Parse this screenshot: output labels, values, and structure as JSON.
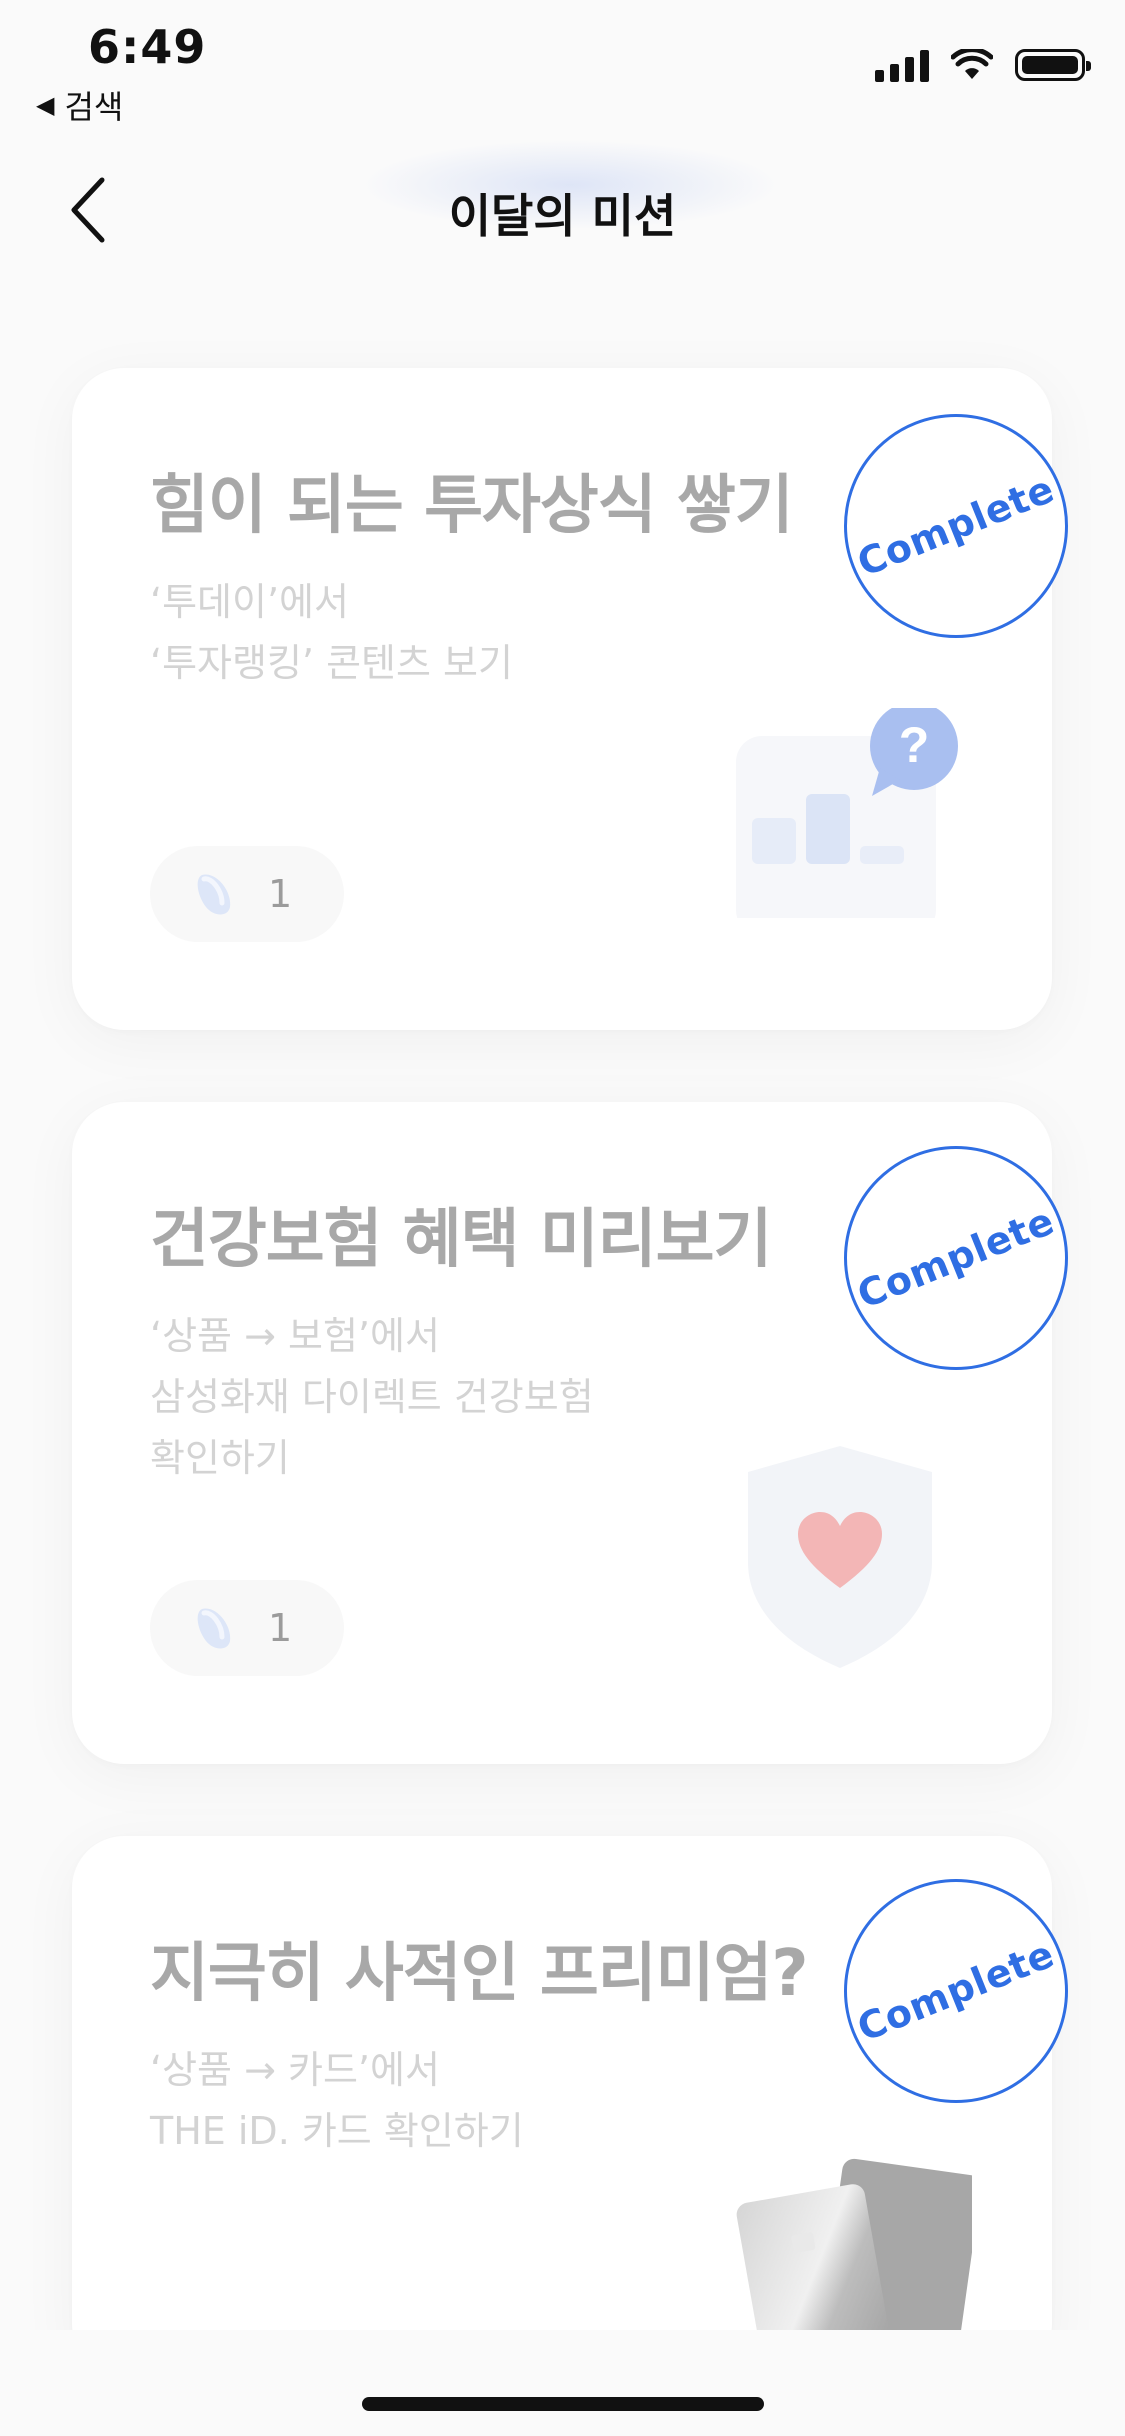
{
  "status_bar": {
    "time": "6:49",
    "back_app_label": "검색"
  },
  "header": {
    "title": "이달의 미션"
  },
  "missions": [
    {
      "title": "힘이 되는 투자상식 쌓기",
      "desc": [
        "‘투데이’에서",
        "‘투자랭킹’ 콘텐츠 보기"
      ],
      "reward": "1",
      "stamp": "Complete"
    },
    {
      "title": "건강보험 혜택 미리보기",
      "desc": [
        "‘상품 → 보험’에서",
        "삼성화재 다이렉트 건강보험",
        "확인하기"
      ],
      "reward": "1",
      "stamp": "Complete"
    },
    {
      "title": "지극히 사적인 프리미엄?",
      "desc": [
        "‘상품 → 카드’에서",
        "THE iD. 카드 확인하기"
      ],
      "stamp": "Complete"
    }
  ],
  "colors": {
    "accent": "#2f6ee3",
    "background": "#fafafa",
    "card": "#ffffff"
  }
}
